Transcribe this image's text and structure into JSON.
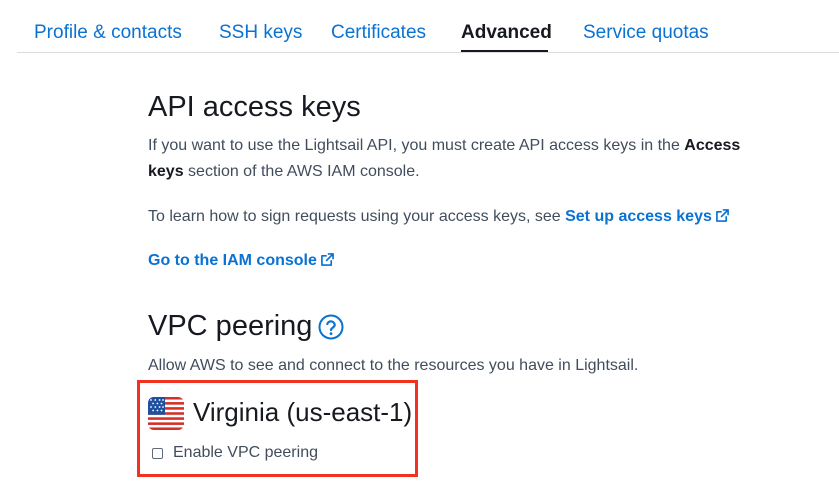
{
  "tabs": [
    {
      "label": "Profile & contacts",
      "active": false
    },
    {
      "label": "SSH keys",
      "active": false
    },
    {
      "label": "Certificates",
      "active": false
    },
    {
      "label": "Advanced",
      "active": true
    },
    {
      "label": "Service quotas",
      "active": false
    }
  ],
  "api_keys": {
    "title": "API access keys",
    "desc_line1_pre": "If you want to use the Lightsail API, you must create API access keys in the ",
    "desc_line1_bold": "Access",
    "desc_line2_bold": "keys",
    "desc_line2_post": " section of the AWS IAM console.",
    "learn_pre": "To learn how to sign requests using your access keys, see ",
    "learn_link": "Set up access keys",
    "iam_link": "Go to the IAM console"
  },
  "vpc": {
    "title": "VPC peering",
    "description": "Allow AWS to see and connect to the resources you have in Lightsail.",
    "region_name": "Virginia (us-east-1)",
    "checkbox_label": "Enable VPC peering",
    "checkbox_checked": false
  },
  "colors": {
    "link": "#0972d3",
    "highlight_border": "#f0321e"
  }
}
